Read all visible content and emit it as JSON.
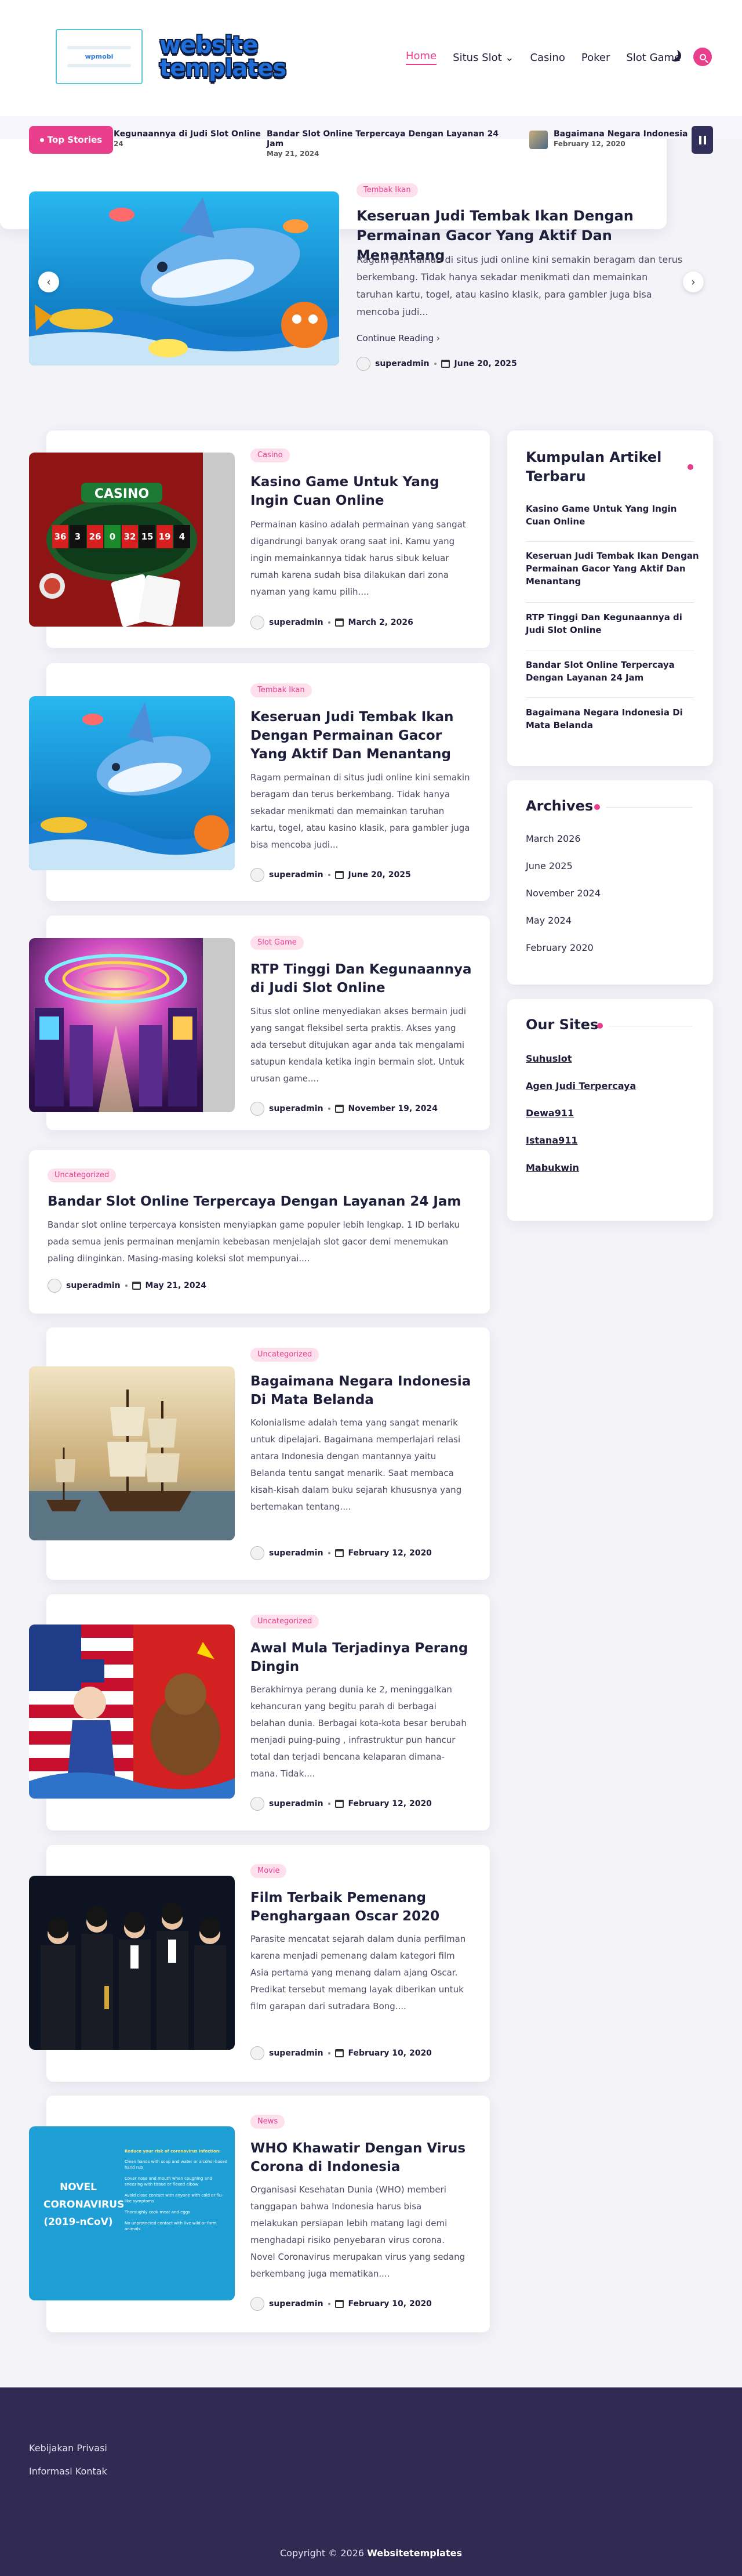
{
  "header": {
    "logo_small_text": "wpmobi",
    "logo_line1": "website",
    "logo_line2": "templates",
    "nav": [
      {
        "label": "Home"
      },
      {
        "label": "Situs Slot ⌄"
      },
      {
        "label": "Casino"
      },
      {
        "label": "Poker"
      },
      {
        "label": "Slot Game"
      }
    ]
  },
  "ticker": {
    "label": "Top Stories",
    "items": [
      {
        "title": "Kegunaannya di Judi Slot Online",
        "date": "24"
      },
      {
        "title": "Bandar Slot Online Terpercaya Dengan Layanan 24 Jam",
        "date": "May 21, 2024"
      },
      {
        "title": "Bagaimana Negara Indonesia",
        "date": "February 12, 2020"
      }
    ]
  },
  "hero": {
    "badge": "Tembak Ikan",
    "title": "Keseruan Judi Tembak Ikan Dengan Permainan Gacor Yang Aktif Dan Menantang",
    "excerpt": "Ragam permainan di situs judi online kini semakin beragam dan terus berkembang. Tidak hanya sekadar menikmati dan memainkan taruhan kartu, togel, atau kasino klasik, para gambler juga bisa mencoba judi...",
    "continue_label": "Continue Reading ›",
    "author": "superadmin",
    "date": "June 20, 2025"
  },
  "posts": [
    {
      "badge": "Casino",
      "title": "Kasino Game Untuk Yang Ingin Cuan Online",
      "excerpt": "Permainan kasino adalah permainan yang sangat digandrungi banyak orang saat ini. Kamu yang ingin memainkannya tidak harus sibuk keluar rumah karena sudah bisa dilakukan dari zona nyaman yang kamu pilih....",
      "author": "superadmin",
      "date": "March 2, 2026"
    },
    {
      "badge": "Tembak Ikan",
      "title": "Keseruan Judi Tembak Ikan Dengan Permainan Gacor Yang Aktif Dan Menantang",
      "excerpt": "Ragam permainan di situs judi online kini semakin beragam dan terus berkembang. Tidak hanya sekadar menikmati dan memainkan taruhan kartu, togel, atau kasino klasik, para gambler juga bisa mencoba judi...",
      "author": "superadmin",
      "date": "June 20, 2025"
    },
    {
      "badge": "Slot Game",
      "title": "RTP Tinggi Dan Kegunaannya di Judi Slot Online",
      "excerpt": "Situs slot online menyediakan akses bermain judi yang sangat fleksibel serta praktis. Akses yang ada tersebut ditujukan agar anda tak mengalami satupun kendala ketika ingin bermain slot. Untuk urusan game....",
      "author": "superadmin",
      "date": "November 19, 2024"
    },
    {
      "badge": "Uncategorized",
      "title": "Bandar Slot Online Terpercaya Dengan Layanan 24 Jam",
      "excerpt": "Bandar slot online terpercaya konsisten menyiapkan game populer lebih lengkap. 1 ID berlaku pada semua jenis permainan menjamin kebebasan menjelajah slot gacor demi menemukan paling diinginkan. Masing-masing koleksi slot mempunyai....",
      "author": "superadmin",
      "date": "May 21, 2024"
    },
    {
      "badge": "Uncategorized",
      "title": "Bagaimana Negara Indonesia Di Mata Belanda",
      "excerpt": "Kolonialisme adalah tema yang sangat menarik untuk dipelajari. Bagaimana memperlajari relasi antara Indonesia dengan mantannya yaitu Belanda tentu sangat menarik. Saat membaca kisah-kisah dalam buku sejarah khususnya yang bertemakan tentang....",
      "author": "superadmin",
      "date": "February 12, 2020"
    },
    {
      "badge": "Uncategorized",
      "title": "Awal Mula Terjadinya Perang Dingin",
      "excerpt": "Berakhirnya perang dunia ke 2, meninggalkan kehancuran yang begitu parah di berbagai belahan dunia. Berbagai kota-kota besar berubah menjadi puing-puing , infrastruktur pun hancur total dan terjadi bencana kelaparan dimana-mana. Tidak....",
      "author": "superadmin",
      "date": "February 12, 2020"
    },
    {
      "badge": "Movie",
      "title": "Film Terbaik Pemenang Penghargaan Oscar 2020",
      "excerpt": "Parasite mencatat sejarah dalam dunia perfilman karena menjadi pemenang dalam kategori film Asia pertama yang menang dalam ajang Oscar. Predikat tersebut memang layak diberikan untuk film garapan dari sutradara Bong....",
      "author": "superadmin",
      "date": "February 10, 2020"
    },
    {
      "badge": "News",
      "title": "WHO Khawatir Dengan Virus Corona di Indonesia",
      "excerpt": "Organisasi Kesehatan Dunia (WHO) memberi tanggapan bahwa Indonesia harus bisa melakukan persiapan lebih matang lagi demi menghadapi risiko penyebaran virus corona. Novel Coronavirus merupakan virus yang sedang berkembang juga mematikan....",
      "author": "superadmin",
      "date": "February 10, 2020"
    }
  ],
  "corona_img": {
    "line1": "NOVEL",
    "line2": "CORONAVIRUS",
    "line3": "(2019-nCoV)",
    "heading": "Reduce your risk of coronavirus infection:",
    "tips": [
      "Clean hands with soap and water or alcohol-based hand rub",
      "Cover nose and mouth when coughing and sneezing with tissue or flexed elbow",
      "Avoid close contact with anyone with cold or flu-like symptoms",
      "Thoroughly cook meat and eggs",
      "No unprotected contact with live wild or farm animals"
    ]
  },
  "casino_img": {
    "sign": "CASINO",
    "numbers": [
      "36",
      "3",
      "26",
      "0",
      "32",
      "15",
      "19",
      "4"
    ]
  },
  "sidebar": {
    "latest_title": "Kumpulan Artikel Terbaru",
    "latest": [
      "Kasino Game Untuk Yang Ingin Cuan Online",
      "Keseruan Judi Tembak Ikan Dengan Permainan Gacor Yang Aktif Dan Menantang",
      "RTP Tinggi Dan Kegunaannya di Judi Slot Online",
      "Bandar Slot Online Terpercaya Dengan Layanan 24 Jam",
      "Bagaimana Negara Indonesia Di Mata Belanda"
    ],
    "archives_title": "Archives",
    "archives": [
      "March 2026",
      "June 2025",
      "November 2024",
      "May 2024",
      "February 2020"
    ],
    "sites_title": "Our Sites",
    "sites": [
      "Suhuslot",
      "Agen Judi Terpercaya",
      "Dewa911",
      "Istana911",
      "Mabukwin"
    ]
  },
  "footer": {
    "links": [
      "Kebijakan Privasi",
      "Informasi Kontak"
    ],
    "copyright_prefix": "Copyright © 2026",
    "copyright_site": "Websitetemplates"
  }
}
